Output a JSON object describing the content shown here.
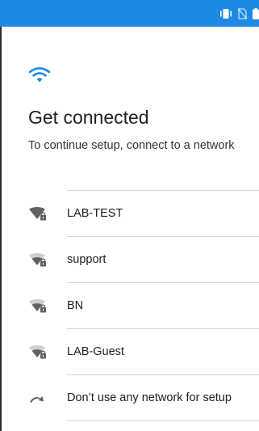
{
  "status_bar": {
    "color": "#1e88e5",
    "icons": [
      "vibrate-icon",
      "no-sim-icon",
      "battery-icon"
    ]
  },
  "header": {
    "icon": "wifi-icon",
    "icon_color": "#1e88e5",
    "title": "Get connected",
    "subtitle": "To continue setup, connect to a network"
  },
  "networks": [
    {
      "label": "LAB-TEST",
      "icon": "wifi-locked-icon",
      "signal": "strong"
    },
    {
      "label": "support",
      "icon": "wifi-locked-icon",
      "signal": "medium"
    },
    {
      "label": "BN",
      "icon": "wifi-locked-icon",
      "signal": "medium"
    },
    {
      "label": "LAB-Guest",
      "icon": "wifi-locked-icon",
      "signal": "medium"
    },
    {
      "label": "Don’t use any network for setup",
      "icon": "skip-arrow-icon"
    }
  ]
}
